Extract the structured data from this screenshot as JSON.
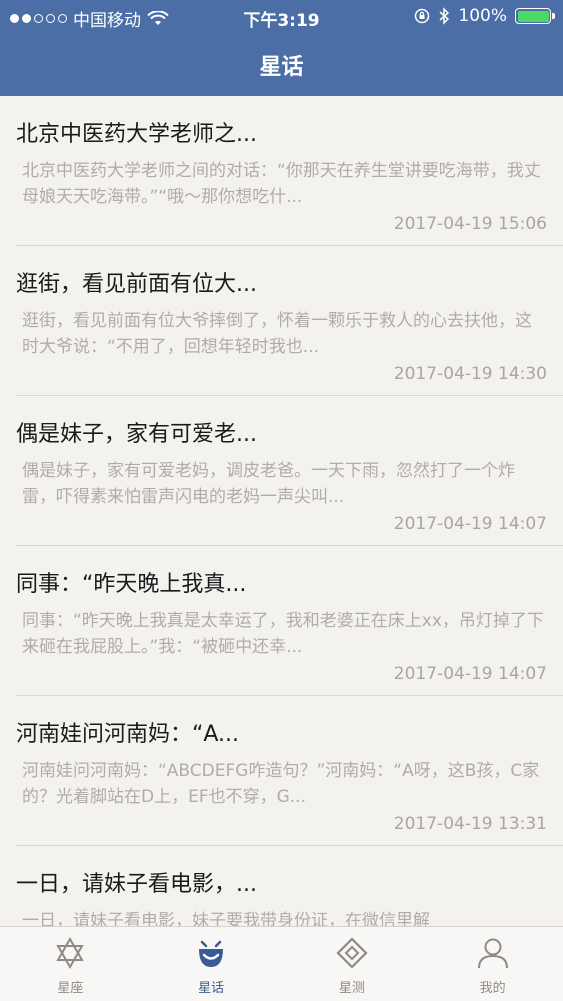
{
  "statusbar": {
    "carrier": "中国移动",
    "time": "下午3:19",
    "battery_percent": "100%"
  },
  "navbar": {
    "title": "星话"
  },
  "posts": [
    {
      "title": "北京中医药大学老师之...",
      "excerpt": "北京中医药大学老师之间的对话：“你那天在养生堂讲要吃海带，我丈母娘天天吃海带。”“哦～那你想吃什...",
      "date": "2017-04-19 15:06"
    },
    {
      "title": "逛街，看见前面有位大...",
      "excerpt": "逛街，看见前面有位大爷摔倒了，怀着一颗乐于救人的心去扶他，这时大爷说：“不用了，回想年轻时我也...",
      "date": "2017-04-19 14:30"
    },
    {
      "title": "偶是妹子，家有可爱老...",
      "excerpt": "偶是妹子，家有可爱老妈，调皮老爸。一天下雨，忽然打了一个炸雷，吓得素来怕雷声闪电的老妈一声尖叫...",
      "date": "2017-04-19 14:07"
    },
    {
      "title": "同事：“昨天晚上我真...",
      "excerpt": "同事：“昨天晚上我真是太幸运了，我和老婆正在床上xx，吊灯掉了下来砸在我屁股上。”我：“被砸中还幸...",
      "date": "2017-04-19 14:07"
    },
    {
      "title": "河南娃问河南妈：“A...",
      "excerpt": "河南娃问河南妈：“ABCDEFG咋造句？”河南妈：“A呀，这B孩，C家的？光着脚站在D上，EF也不穿，G...",
      "date": "2017-04-19 13:31"
    },
    {
      "title": "一日，请妹子看电影，...",
      "excerpt": "一日，请妹子看电影，妹子要我带身份证，在微信里解",
      "date": ""
    }
  ],
  "tabs": [
    {
      "label": "星座",
      "icon": "star-of-david-icon"
    },
    {
      "label": "星话",
      "icon": "smile-face-icon"
    },
    {
      "label": "星测",
      "icon": "diamond-icon"
    },
    {
      "label": "我的",
      "icon": "person-icon"
    }
  ],
  "colors": {
    "header": "#4a6ea5",
    "active_tab": "#3a5a93",
    "inactive_tab": "#8e8a86",
    "background": "#f4f2ef"
  }
}
